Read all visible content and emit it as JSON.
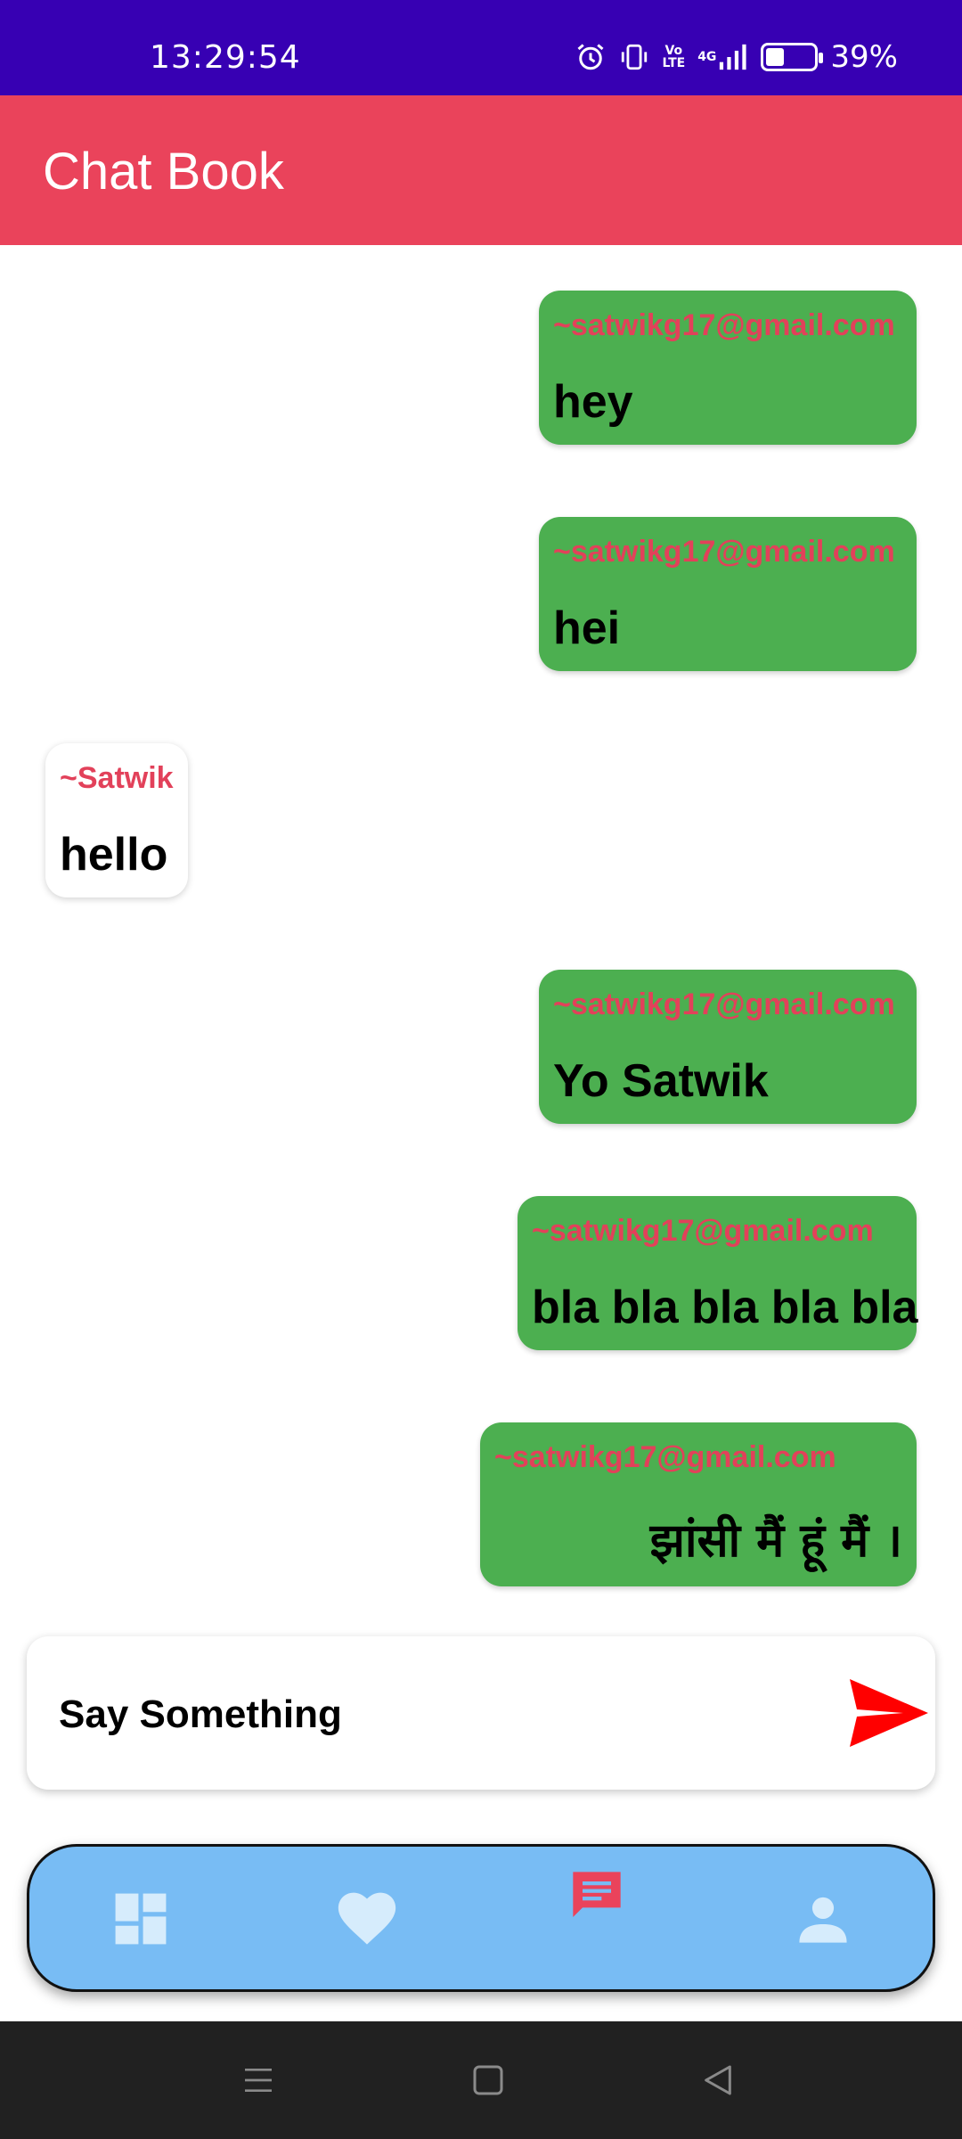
{
  "status_bar": {
    "time": "13:29:54",
    "volte_top": "Vo",
    "volte_bottom": "LTE",
    "network": "4G",
    "battery_percent": "39%",
    "battery_level": 0.39,
    "icons": [
      "alarm-icon",
      "vibrate-icon",
      "volte-icon",
      "signal-icon",
      "battery-icon"
    ]
  },
  "app_bar": {
    "title": "Chat Book",
    "color": "#ea435b"
  },
  "messages": [
    {
      "sender": "~satwikg17@gmail.com",
      "text": "hey",
      "direction": "sent"
    },
    {
      "sender": "~satwikg17@gmail.com",
      "text": "hei",
      "direction": "sent"
    },
    {
      "sender": "~Satwik",
      "text": "hello",
      "direction": "received"
    },
    {
      "sender": "~satwikg17@gmail.com",
      "text": "Yo Satwik",
      "direction": "sent"
    },
    {
      "sender": "~satwikg17@gmail.com",
      "text": "bla bla bla bla bla",
      "direction": "sent"
    },
    {
      "sender": "~satwikg17@gmail.com",
      "text": "झांसी मैं हूं  मैं ।",
      "direction": "sent"
    }
  ],
  "composer": {
    "placeholder": "Say Something",
    "value": "",
    "send_icon": "send-icon"
  },
  "bottom_nav": {
    "items": [
      {
        "icon": "dashboard-icon",
        "active": false
      },
      {
        "icon": "heart-icon",
        "active": false
      },
      {
        "icon": "chat-icon",
        "active": true
      },
      {
        "icon": "person-icon",
        "active": false
      }
    ]
  },
  "system_nav": {
    "items": [
      "menu-icon",
      "home-icon",
      "back-icon"
    ]
  },
  "colors": {
    "status_bar": "#3700b3",
    "sent_bubble": "#4caf50",
    "sender_label": "#e2415a",
    "nav_background": "#78bcf4",
    "nav_inactive": "#d6ecfc",
    "nav_active": "#ea435b",
    "send_arrow": "#ff0000"
  }
}
